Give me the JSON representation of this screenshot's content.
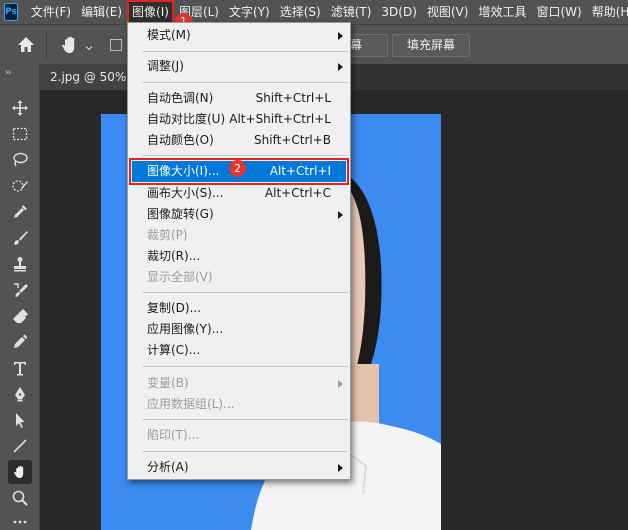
{
  "app": {
    "logo_text": "Ps"
  },
  "menubar": {
    "items": [
      "文件(F)",
      "编辑(E)",
      "图像(I)",
      "图层(L)",
      "文字(Y)",
      "选择(S)",
      "滤镜(T)",
      "3D(D)",
      "视图(V)",
      "增效工具",
      "窗口(W)",
      "帮助(H)"
    ]
  },
  "options": {
    "fit_screen_label": "屏幕",
    "fill_screen_label": "填充屏幕"
  },
  "document": {
    "tab_label": "2.jpg @ 50%("
  },
  "badges": {
    "one": "1",
    "two": "2"
  },
  "dropdown": {
    "mode": "模式(M)",
    "adjust": "调整(J)",
    "auto_tone": "自动色调(N)",
    "auto_tone_sc": "Shift+Ctrl+L",
    "auto_contrast": "自动对比度(U)",
    "auto_contrast_sc": "Alt+Shift+Ctrl+L",
    "auto_color": "自动颜色(O)",
    "auto_color_sc": "Shift+Ctrl+B",
    "image_size": "图像大小(I)...",
    "image_size_sc": "Alt+Ctrl+I",
    "canvas_size": "画布大小(S)...",
    "canvas_size_sc": "Alt+Ctrl+C",
    "image_rotation": "图像旋转(G)",
    "crop": "裁剪(P)",
    "trim": "裁切(R)...",
    "reveal_all": "显示全部(V)",
    "duplicate": "复制(D)...",
    "apply_image": "应用图像(Y)...",
    "calculations": "计算(C)...",
    "variables": "变量(B)",
    "apply_data_set": "应用数据组(L)...",
    "trap": "陷印(T)...",
    "analysis": "分析(A)"
  },
  "colors": {
    "photo_bg": "#3b8bf1",
    "highlight": "#0078d7",
    "callout": "#e53434"
  }
}
